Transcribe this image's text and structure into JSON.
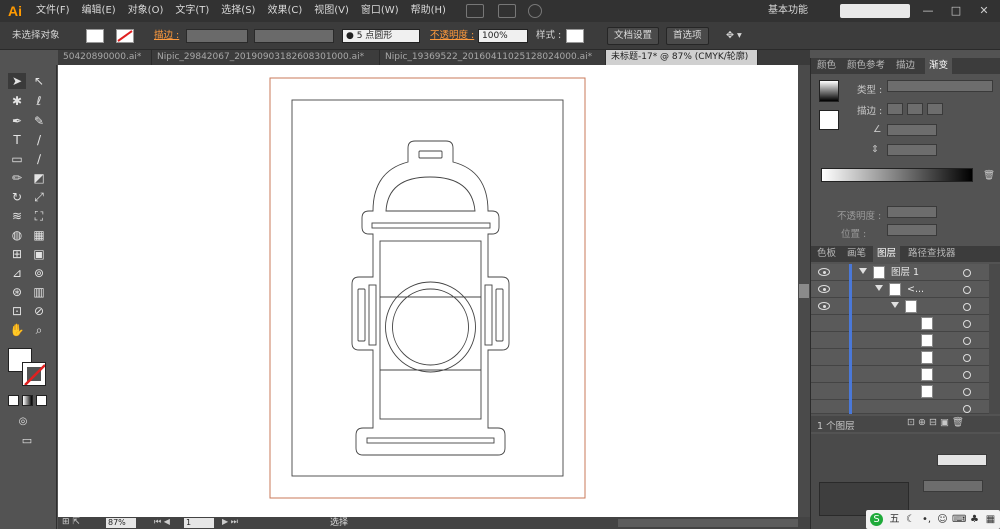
{
  "app": {
    "logo": "Ai"
  },
  "menu": [
    "文件(F)",
    "编辑(E)",
    "对象(O)",
    "文字(T)",
    "选择(S)",
    "效果(C)",
    "视图(V)",
    "窗口(W)",
    "帮助(H)"
  ],
  "workspace": "基本功能",
  "control_bar": {
    "selection": "未选择对象",
    "stroke_label": "描边 :",
    "brush": "5 点圆形",
    "opacity_label": "不透明度 :",
    "opacity_value": "100%",
    "style_label": "样式 :",
    "doc_setup": "文档设置",
    "preferences": "首选项"
  },
  "tabs": [
    "50420890000.ai*",
    "Nipic_29842067_20190903182608301000.ai*",
    "Nipic_19369522_20160411025128024000.ai*",
    "未标题-17* @ 87% (CMYK/轮廓)"
  ],
  "gradient_panel": {
    "tabs": [
      "颜色",
      "颜色参考",
      "描边",
      "渐变"
    ],
    "type_label": "类型 :",
    "stroke_label": "描边 :",
    "opacity_label": "不透明度 :",
    "position_label": "位置 :"
  },
  "layers_panel": {
    "tabs": [
      "色板",
      "画笔",
      "图层",
      "路径查找器"
    ],
    "layer_name": "图层 1",
    "group_name": "<...",
    "footer": "1 个图层"
  },
  "status": {
    "zoom": "87%",
    "page": "1",
    "tool": "选择"
  },
  "tray": {
    "ime": "五"
  }
}
